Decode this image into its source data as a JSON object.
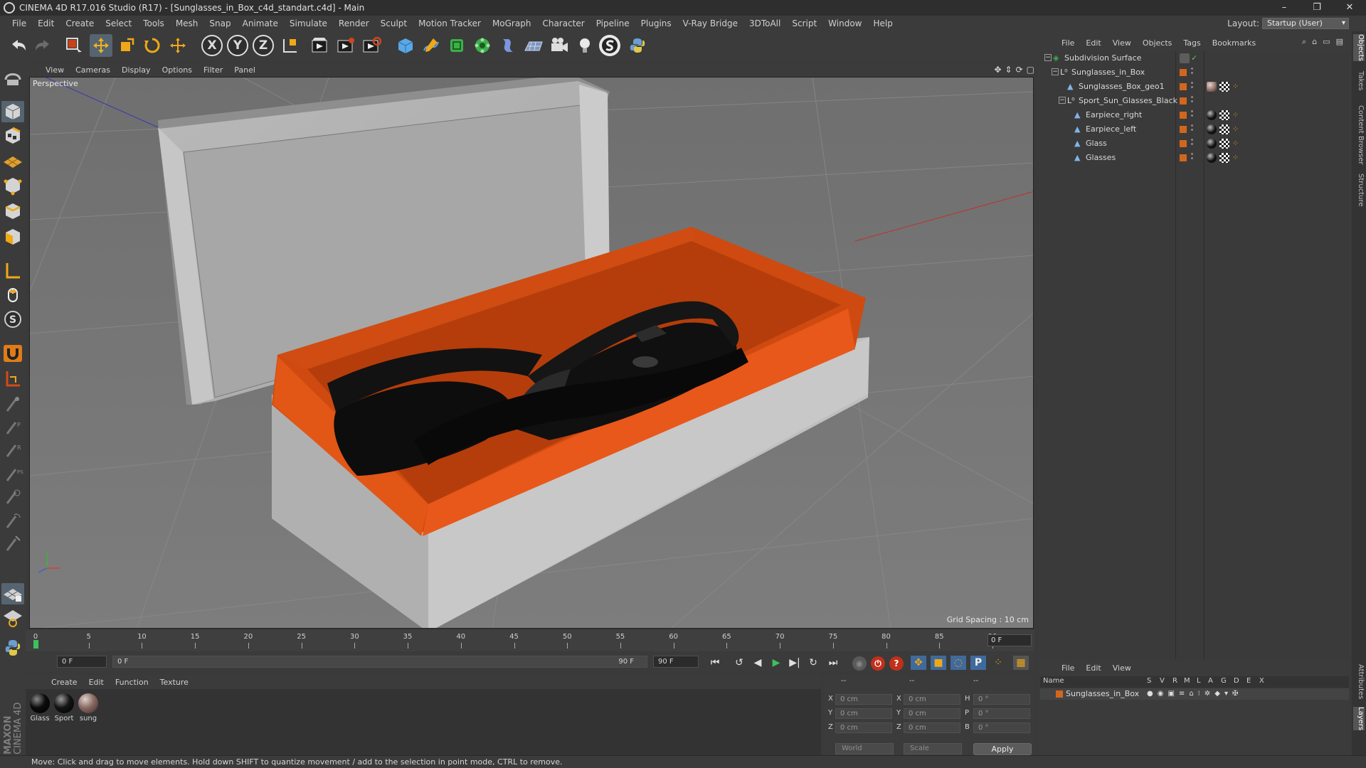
{
  "window": {
    "title": "CINEMA 4D R17.016 Studio (R17) - [Sunglasses_in_Box_c4d_standart.c4d] - Main",
    "controls": [
      "–",
      "❐",
      "✕"
    ]
  },
  "menubar": [
    "File",
    "Edit",
    "Create",
    "Select",
    "Tools",
    "Mesh",
    "Snap",
    "Animate",
    "Simulate",
    "Render",
    "Sculpt",
    "Motion Tracker",
    "MoGraph",
    "Character",
    "Pipeline",
    "Plugins",
    "V-Ray Bridge",
    "3DToAll",
    "Script",
    "Window",
    "Help"
  ],
  "layout": {
    "label": "Layout:",
    "value": "Startup (User)"
  },
  "toolbar": {
    "axis_x": "X",
    "axis_y": "Y",
    "axis_z": "Z"
  },
  "viewport": {
    "menu": [
      "View",
      "Cameras",
      "Display",
      "Options",
      "Filter",
      "Panel"
    ],
    "camera_label": "Perspective",
    "grid_spacing": "Grid Spacing : 10 cm",
    "nav_icons": [
      "move-view-icon",
      "dolly-icon",
      "rotate-view-icon",
      "maximize-icon"
    ]
  },
  "timeline": {
    "ticks": [
      "0",
      "5",
      "10",
      "15",
      "20",
      "25",
      "30",
      "35",
      "40",
      "45",
      "50",
      "55",
      "60",
      "65",
      "70",
      "75",
      "80",
      "85",
      "90"
    ],
    "current_frame": "0 F"
  },
  "transport": {
    "start_field": "0 F",
    "range_start": "0 F",
    "range_end": "90 F",
    "end_field": "90 F"
  },
  "materials": {
    "menu": [
      "Create",
      "Edit",
      "Function",
      "Texture"
    ],
    "items": [
      {
        "name": "Glass",
        "color": "#0b0b0b"
      },
      {
        "name": "Sport",
        "color": "#141414"
      },
      {
        "name": "sung",
        "color": "#8a6b63"
      }
    ]
  },
  "coords": {
    "header": [
      "--",
      "--",
      "--"
    ],
    "rows": [
      {
        "axis1": "X",
        "val1": "0 cm",
        "axis2": "X",
        "val2": "0 cm",
        "axis3": "H",
        "val3": "0 °"
      },
      {
        "axis1": "Y",
        "val1": "0 cm",
        "axis2": "Y",
        "val2": "0 cm",
        "axis3": "P",
        "val3": "0 °"
      },
      {
        "axis1": "Z",
        "val1": "0 cm",
        "axis2": "Z",
        "val2": "0 cm",
        "axis3": "B",
        "val3": "0 °"
      }
    ],
    "mode": "World",
    "type": "Scale",
    "apply": "Apply"
  },
  "status": "Move: Click and drag to move elements. Hold down SHIFT to quantize movement / add to the selection in point mode, CTRL to remove.",
  "object_manager": {
    "menu": [
      "File",
      "Edit",
      "View",
      "Objects",
      "Tags",
      "Bookmarks"
    ],
    "objects": [
      {
        "name": "Subdivision Surface",
        "indent": 0,
        "expand": "−",
        "icon": "subdivision-icon",
        "tags": [
          "check"
        ]
      },
      {
        "name": "Sunglasses_in_Box",
        "indent": 1,
        "expand": "−",
        "icon": "null-icon",
        "tags": []
      },
      {
        "name": "Sunglasses_Box_geo1",
        "indent": 2,
        "expand": "",
        "icon": "polygon-icon",
        "tags": [
          "mat-brown",
          "checker",
          "dots"
        ]
      },
      {
        "name": "Sport_Sun_Glasses_Black",
        "indent": 2,
        "expand": "−",
        "icon": "null-icon",
        "tags": []
      },
      {
        "name": "Earpiece_right",
        "indent": 3,
        "expand": "",
        "icon": "polygon-icon",
        "tags": [
          "mat-black",
          "checker",
          "dots"
        ]
      },
      {
        "name": "Earpiece_left",
        "indent": 3,
        "expand": "",
        "icon": "polygon-icon",
        "tags": [
          "mat-black",
          "checker",
          "dots"
        ]
      },
      {
        "name": "Glass",
        "indent": 3,
        "expand": "",
        "icon": "polygon-icon",
        "tags": [
          "mat-black",
          "checker",
          "dots"
        ]
      },
      {
        "name": "Glasses",
        "indent": 3,
        "expand": "",
        "icon": "polygon-icon",
        "tags": [
          "mat-black",
          "checker",
          "dots"
        ]
      }
    ]
  },
  "layer_manager": {
    "menu": [
      "File",
      "Edit",
      "View"
    ],
    "columns": [
      "Name",
      "S",
      "V",
      "R",
      "M",
      "L",
      "A",
      "G",
      "D",
      "E",
      "X"
    ],
    "layers": [
      {
        "name": "Sunglasses_in_Box",
        "color": "#d2661e"
      }
    ]
  },
  "side_tabs": [
    "Objects",
    "Takes",
    "Content Browser",
    "Structure",
    "Attributes",
    "Layers"
  ],
  "colors": {
    "accent_orange": "#d2661e",
    "viewport_bg": "#777777",
    "box_inner": "#cf4a10"
  }
}
